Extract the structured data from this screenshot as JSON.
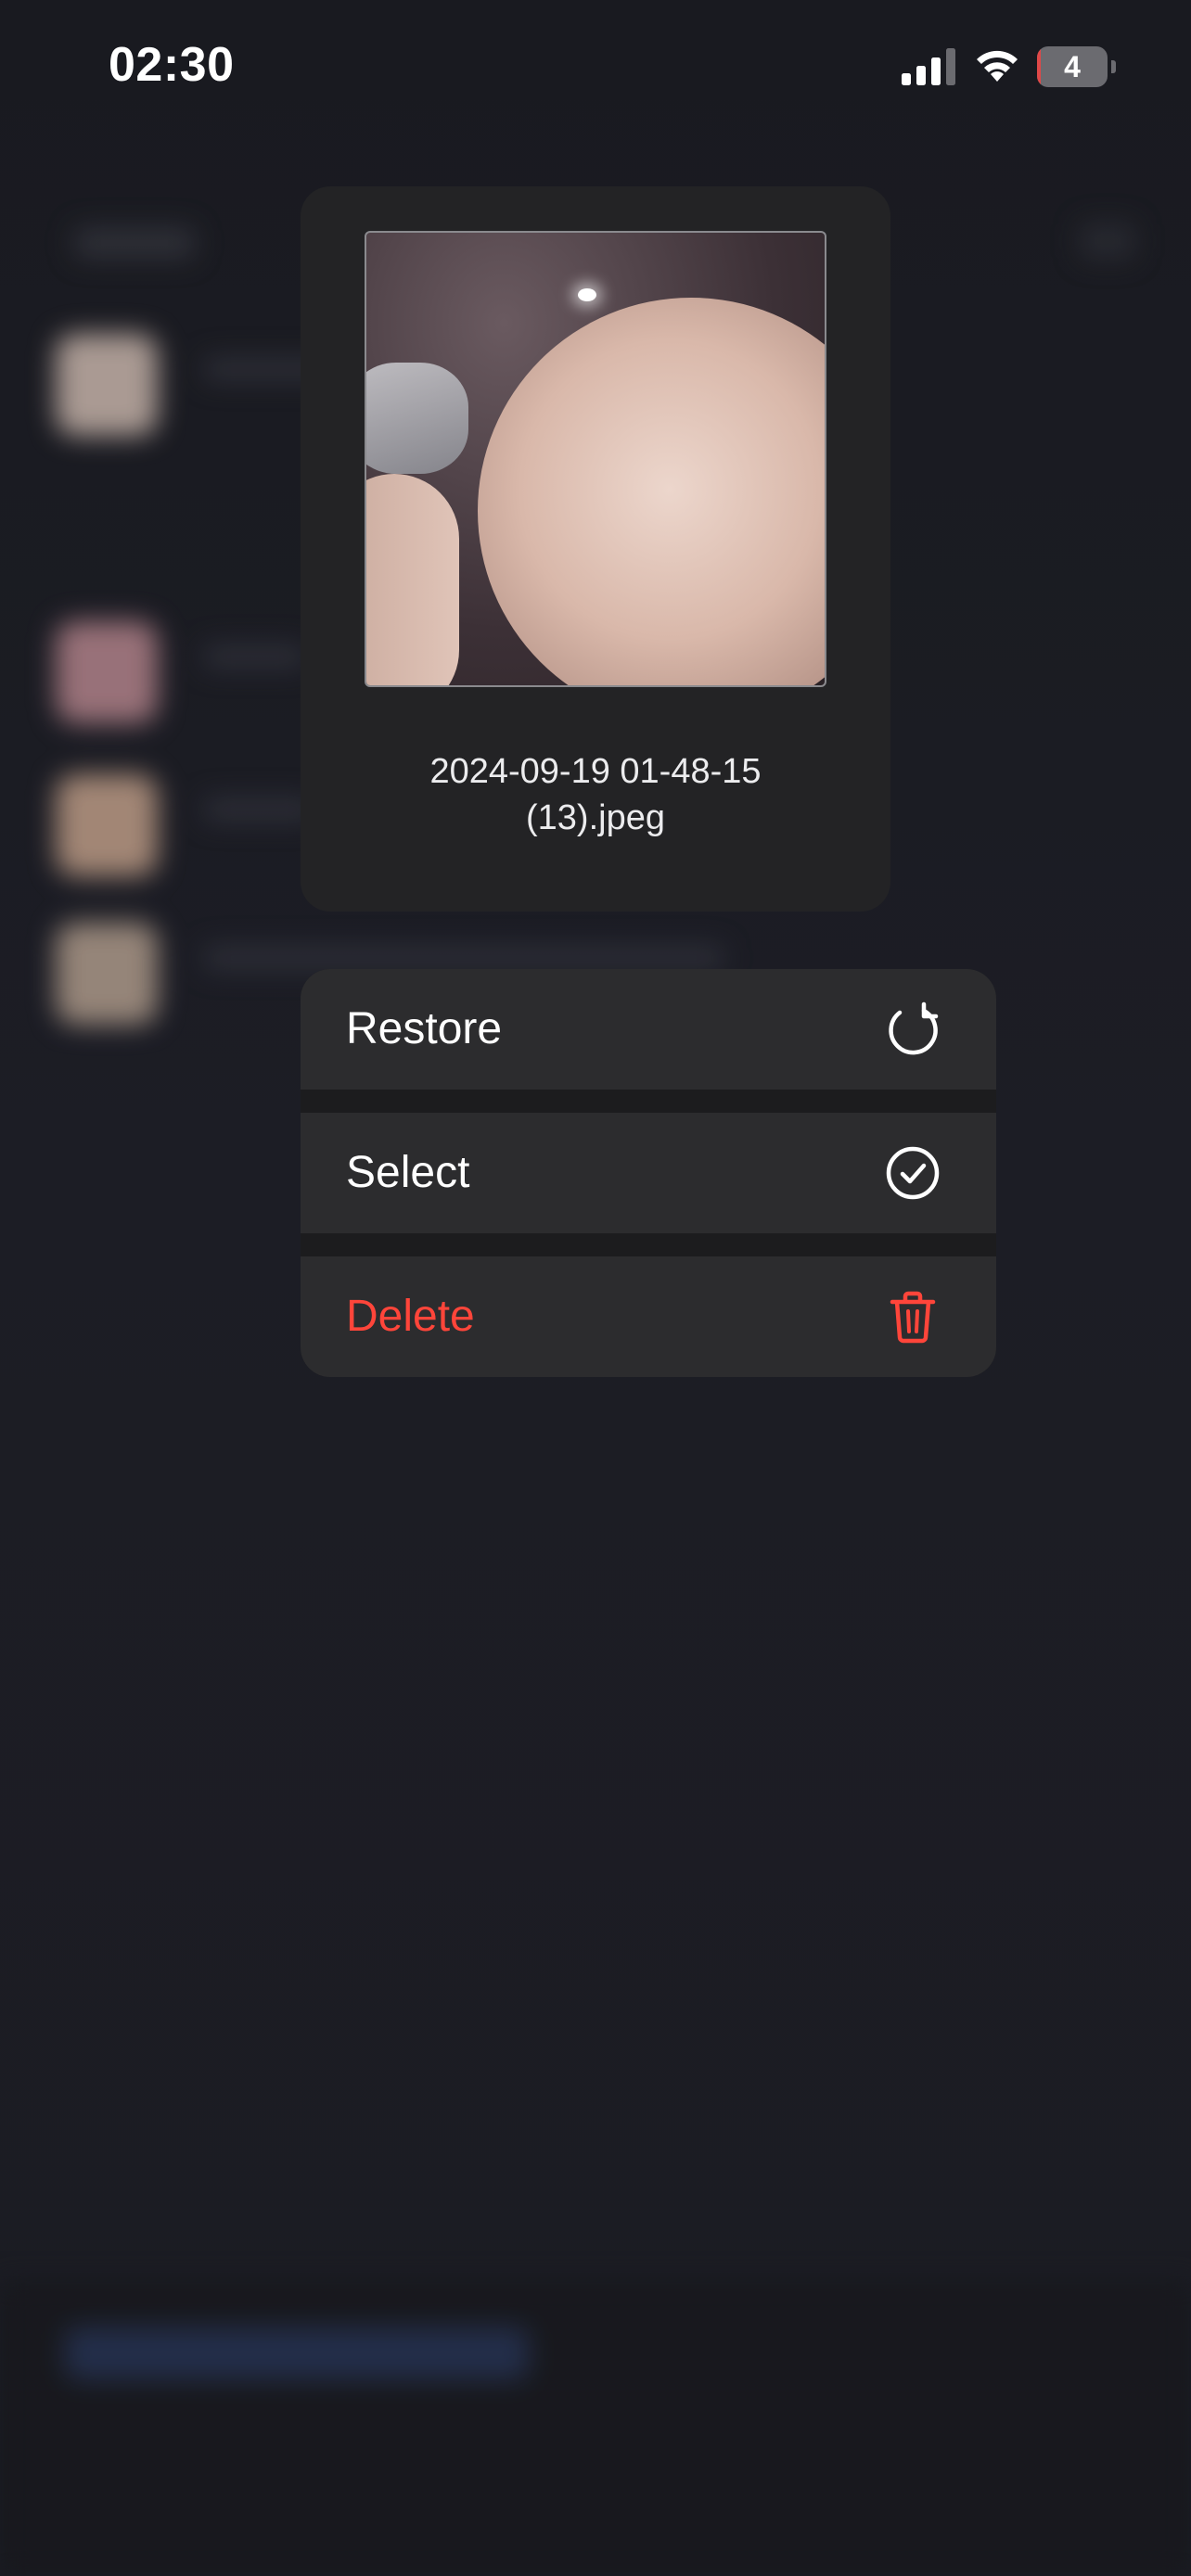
{
  "status_bar": {
    "time": "02:30",
    "battery_level": "4",
    "battery_fraction": 0.04,
    "signal_icon": "cellular-signal-icon",
    "wifi_icon": "wifi-icon",
    "battery_icon": "battery-icon"
  },
  "preview": {
    "filename_line1": "2024-09-19 01-48-15",
    "filename_line2": "(13).jpeg"
  },
  "menu": {
    "restore": {
      "label": "Restore",
      "icon": "restore-icon"
    },
    "select": {
      "label": "Select",
      "icon": "checkmark-circle-icon"
    },
    "delete": {
      "label": "Delete",
      "icon": "trash-icon"
    }
  },
  "colors": {
    "destructive": "#ff453a",
    "menu_background": "#2c2c2e",
    "card_background": "#232325",
    "page_background": "#1f2026"
  }
}
